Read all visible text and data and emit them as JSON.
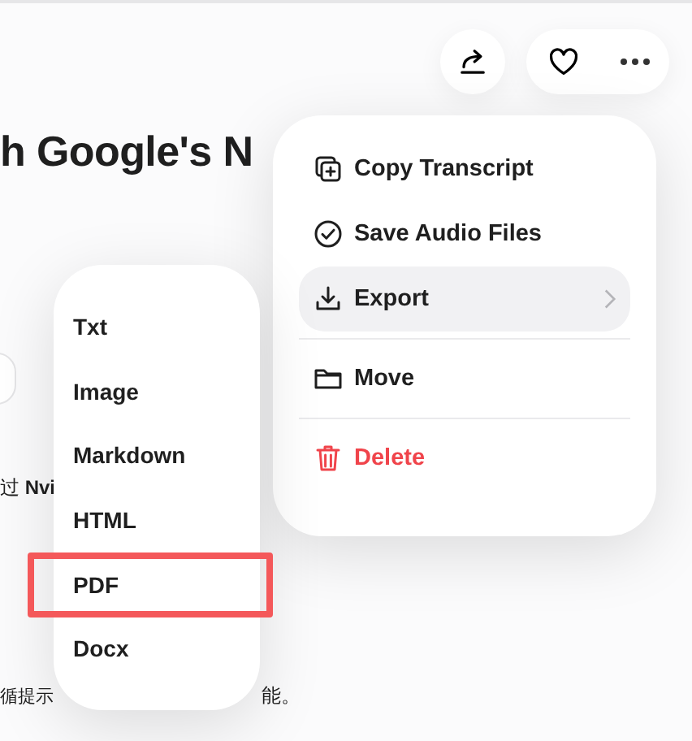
{
  "article": {
    "title": "h Google's N",
    "lines": [
      {
        "start": "过 **Nvi**"
      },
      {
        "start": "循提示",
        "end": "能。"
      }
    ]
  },
  "toolbar": {
    "favorite": false
  },
  "menu": {
    "items": [
      {
        "kind": "copy",
        "label": "Copy Transcript",
        "selected": false
      },
      {
        "kind": "save",
        "label": "Save Audio Files",
        "selected": false
      },
      {
        "kind": "export",
        "label": "Export",
        "selected": true
      },
      {
        "kind": "move",
        "label": "Move",
        "selected": false
      },
      {
        "kind": "delete",
        "label": "Delete",
        "selected": false
      }
    ]
  },
  "export_menu": {
    "items": [
      {
        "label": "Txt",
        "highlighted": false
      },
      {
        "label": "Image",
        "highlighted": false
      },
      {
        "label": "Markdown",
        "highlighted": false
      },
      {
        "label": "HTML",
        "highlighted": false
      },
      {
        "label": "PDF",
        "highlighted": true
      },
      {
        "label": "Docx",
        "highlighted": false
      }
    ]
  }
}
